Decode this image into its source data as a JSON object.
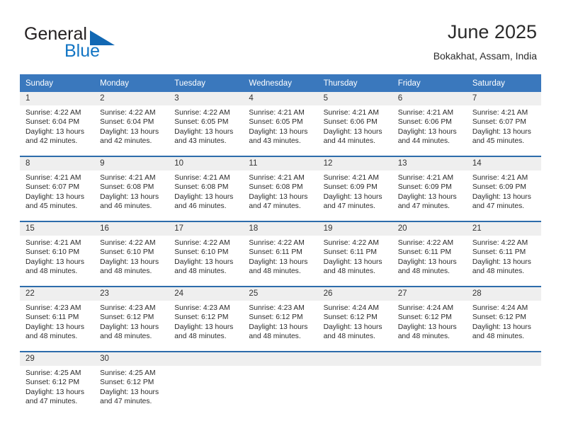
{
  "brand": {
    "name_part1": "General",
    "name_part2": "Blue",
    "triangle_icon": "triangle-icon",
    "colors": {
      "dark": "#231f20",
      "blue": "#1275c4",
      "triangle": "#1268b3"
    }
  },
  "header": {
    "title": "June 2025",
    "subtitle": "Bokakhat, Assam, India"
  },
  "calendar": {
    "accent_header_bg": "#3a78bd",
    "row_divider": "#2d6cab",
    "daynum_band_bg": "#efefef",
    "weekday_headers": [
      "Sunday",
      "Monday",
      "Tuesday",
      "Wednesday",
      "Thursday",
      "Friday",
      "Saturday"
    ],
    "weeks": [
      [
        {
          "day": "1",
          "sunrise": "Sunrise: 4:22 AM",
          "sunset": "Sunset: 6:04 PM",
          "daylight_line1": "Daylight: 13 hours",
          "daylight_line2": "and 42 minutes."
        },
        {
          "day": "2",
          "sunrise": "Sunrise: 4:22 AM",
          "sunset": "Sunset: 6:04 PM",
          "daylight_line1": "Daylight: 13 hours",
          "daylight_line2": "and 42 minutes."
        },
        {
          "day": "3",
          "sunrise": "Sunrise: 4:22 AM",
          "sunset": "Sunset: 6:05 PM",
          "daylight_line1": "Daylight: 13 hours",
          "daylight_line2": "and 43 minutes."
        },
        {
          "day": "4",
          "sunrise": "Sunrise: 4:21 AM",
          "sunset": "Sunset: 6:05 PM",
          "daylight_line1": "Daylight: 13 hours",
          "daylight_line2": "and 43 minutes."
        },
        {
          "day": "5",
          "sunrise": "Sunrise: 4:21 AM",
          "sunset": "Sunset: 6:06 PM",
          "daylight_line1": "Daylight: 13 hours",
          "daylight_line2": "and 44 minutes."
        },
        {
          "day": "6",
          "sunrise": "Sunrise: 4:21 AM",
          "sunset": "Sunset: 6:06 PM",
          "daylight_line1": "Daylight: 13 hours",
          "daylight_line2": "and 44 minutes."
        },
        {
          "day": "7",
          "sunrise": "Sunrise: 4:21 AM",
          "sunset": "Sunset: 6:07 PM",
          "daylight_line1": "Daylight: 13 hours",
          "daylight_line2": "and 45 minutes."
        }
      ],
      [
        {
          "day": "8",
          "sunrise": "Sunrise: 4:21 AM",
          "sunset": "Sunset: 6:07 PM",
          "daylight_line1": "Daylight: 13 hours",
          "daylight_line2": "and 45 minutes."
        },
        {
          "day": "9",
          "sunrise": "Sunrise: 4:21 AM",
          "sunset": "Sunset: 6:08 PM",
          "daylight_line1": "Daylight: 13 hours",
          "daylight_line2": "and 46 minutes."
        },
        {
          "day": "10",
          "sunrise": "Sunrise: 4:21 AM",
          "sunset": "Sunset: 6:08 PM",
          "daylight_line1": "Daylight: 13 hours",
          "daylight_line2": "and 46 minutes."
        },
        {
          "day": "11",
          "sunrise": "Sunrise: 4:21 AM",
          "sunset": "Sunset: 6:08 PM",
          "daylight_line1": "Daylight: 13 hours",
          "daylight_line2": "and 47 minutes."
        },
        {
          "day": "12",
          "sunrise": "Sunrise: 4:21 AM",
          "sunset": "Sunset: 6:09 PM",
          "daylight_line1": "Daylight: 13 hours",
          "daylight_line2": "and 47 minutes."
        },
        {
          "day": "13",
          "sunrise": "Sunrise: 4:21 AM",
          "sunset": "Sunset: 6:09 PM",
          "daylight_line1": "Daylight: 13 hours",
          "daylight_line2": "and 47 minutes."
        },
        {
          "day": "14",
          "sunrise": "Sunrise: 4:21 AM",
          "sunset": "Sunset: 6:09 PM",
          "daylight_line1": "Daylight: 13 hours",
          "daylight_line2": "and 47 minutes."
        }
      ],
      [
        {
          "day": "15",
          "sunrise": "Sunrise: 4:21 AM",
          "sunset": "Sunset: 6:10 PM",
          "daylight_line1": "Daylight: 13 hours",
          "daylight_line2": "and 48 minutes."
        },
        {
          "day": "16",
          "sunrise": "Sunrise: 4:22 AM",
          "sunset": "Sunset: 6:10 PM",
          "daylight_line1": "Daylight: 13 hours",
          "daylight_line2": "and 48 minutes."
        },
        {
          "day": "17",
          "sunrise": "Sunrise: 4:22 AM",
          "sunset": "Sunset: 6:10 PM",
          "daylight_line1": "Daylight: 13 hours",
          "daylight_line2": "and 48 minutes."
        },
        {
          "day": "18",
          "sunrise": "Sunrise: 4:22 AM",
          "sunset": "Sunset: 6:11 PM",
          "daylight_line1": "Daylight: 13 hours",
          "daylight_line2": "and 48 minutes."
        },
        {
          "day": "19",
          "sunrise": "Sunrise: 4:22 AM",
          "sunset": "Sunset: 6:11 PM",
          "daylight_line1": "Daylight: 13 hours",
          "daylight_line2": "and 48 minutes."
        },
        {
          "day": "20",
          "sunrise": "Sunrise: 4:22 AM",
          "sunset": "Sunset: 6:11 PM",
          "daylight_line1": "Daylight: 13 hours",
          "daylight_line2": "and 48 minutes."
        },
        {
          "day": "21",
          "sunrise": "Sunrise: 4:22 AM",
          "sunset": "Sunset: 6:11 PM",
          "daylight_line1": "Daylight: 13 hours",
          "daylight_line2": "and 48 minutes."
        }
      ],
      [
        {
          "day": "22",
          "sunrise": "Sunrise: 4:23 AM",
          "sunset": "Sunset: 6:11 PM",
          "daylight_line1": "Daylight: 13 hours",
          "daylight_line2": "and 48 minutes."
        },
        {
          "day": "23",
          "sunrise": "Sunrise: 4:23 AM",
          "sunset": "Sunset: 6:12 PM",
          "daylight_line1": "Daylight: 13 hours",
          "daylight_line2": "and 48 minutes."
        },
        {
          "day": "24",
          "sunrise": "Sunrise: 4:23 AM",
          "sunset": "Sunset: 6:12 PM",
          "daylight_line1": "Daylight: 13 hours",
          "daylight_line2": "and 48 minutes."
        },
        {
          "day": "25",
          "sunrise": "Sunrise: 4:23 AM",
          "sunset": "Sunset: 6:12 PM",
          "daylight_line1": "Daylight: 13 hours",
          "daylight_line2": "and 48 minutes."
        },
        {
          "day": "26",
          "sunrise": "Sunrise: 4:24 AM",
          "sunset": "Sunset: 6:12 PM",
          "daylight_line1": "Daylight: 13 hours",
          "daylight_line2": "and 48 minutes."
        },
        {
          "day": "27",
          "sunrise": "Sunrise: 4:24 AM",
          "sunset": "Sunset: 6:12 PM",
          "daylight_line1": "Daylight: 13 hours",
          "daylight_line2": "and 48 minutes."
        },
        {
          "day": "28",
          "sunrise": "Sunrise: 4:24 AM",
          "sunset": "Sunset: 6:12 PM",
          "daylight_line1": "Daylight: 13 hours",
          "daylight_line2": "and 48 minutes."
        }
      ],
      [
        {
          "day": "29",
          "sunrise": "Sunrise: 4:25 AM",
          "sunset": "Sunset: 6:12 PM",
          "daylight_line1": "Daylight: 13 hours",
          "daylight_line2": "and 47 minutes."
        },
        {
          "day": "30",
          "sunrise": "Sunrise: 4:25 AM",
          "sunset": "Sunset: 6:12 PM",
          "daylight_line1": "Daylight: 13 hours",
          "daylight_line2": "and 47 minutes."
        },
        {
          "day": "",
          "sunrise": "",
          "sunset": "",
          "daylight_line1": "",
          "daylight_line2": ""
        },
        {
          "day": "",
          "sunrise": "",
          "sunset": "",
          "daylight_line1": "",
          "daylight_line2": ""
        },
        {
          "day": "",
          "sunrise": "",
          "sunset": "",
          "daylight_line1": "",
          "daylight_line2": ""
        },
        {
          "day": "",
          "sunrise": "",
          "sunset": "",
          "daylight_line1": "",
          "daylight_line2": ""
        },
        {
          "day": "",
          "sunrise": "",
          "sunset": "",
          "daylight_line1": "",
          "daylight_line2": ""
        }
      ]
    ]
  }
}
